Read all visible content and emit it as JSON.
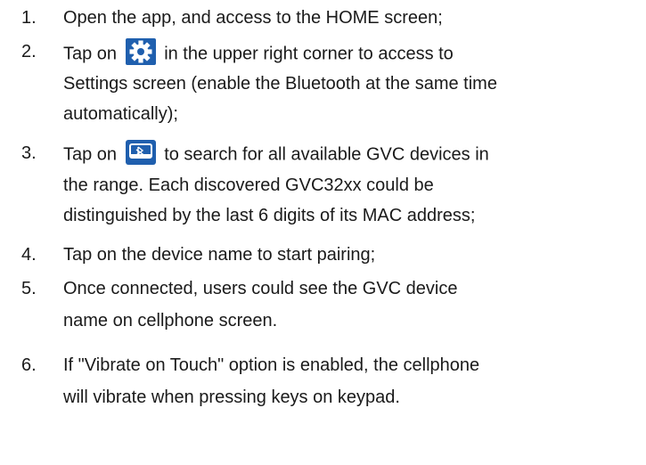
{
  "steps": [
    {
      "num": "1.",
      "lines": [
        "Open the app, and access to the HOME screen;"
      ]
    },
    {
      "num": "2.",
      "before_icon": "Tap on",
      "icon": "gear-icon",
      "after_icon": "in the upper right corner to access to",
      "lines": [
        "Settings screen (enable the Bluetooth at the same time",
        "automatically);"
      ]
    },
    {
      "num": "3.",
      "before_icon": "Tap on",
      "icon": "bluetooth-search-icon",
      "after_icon": "to search for all available GVC devices in",
      "lines": [
        "the range. Each discovered GVC32xx could be",
        "distinguished by the last 6 digits of its MAC address;"
      ]
    },
    {
      "num": "4.",
      "lines": [
        "Tap on the device name to start pairing;"
      ]
    },
    {
      "num": "5.",
      "lines": [
        "Once connected, users could see the GVC device",
        "name on cellphone screen."
      ]
    },
    {
      "num": "6.",
      "lines": [
        "If \"Vibrate on Touch\" option is enabled, the cellphone",
        "will vibrate when pressing keys on keypad."
      ]
    }
  ],
  "colors": {
    "icon_bg": "#1f5fae",
    "text": "#1a1a1a"
  }
}
